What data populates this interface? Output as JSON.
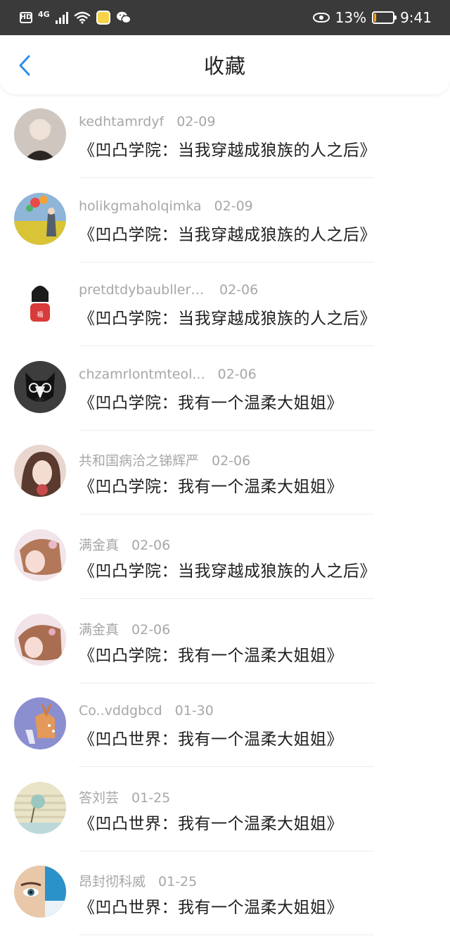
{
  "status_bar": {
    "hd_label": "HD",
    "network_label": "4G",
    "battery_percent_label": "13%",
    "battery_level": 0.13,
    "time": "9:41"
  },
  "header": {
    "title": "收藏",
    "back_icon": "chevron-left-icon"
  },
  "colors": {
    "accent": "#2b8ff0",
    "status_bar_bg": "#3a3a3a",
    "meta_text": "#a7a7a7",
    "title_text": "#1f1f1f"
  },
  "favorites": [
    {
      "username": "kedhtamrdyf",
      "date": "02-09",
      "title": "《凹凸学院：当我穿越成狼族的人之后》"
    },
    {
      "username": "holikgmaholqimka",
      "date": "02-09",
      "title": "《凹凸学院：当我穿越成狼族的人之后》"
    },
    {
      "username": "pretdtdybaublleri...",
      "date": "02-06",
      "title": "《凹凸学院：当我穿越成狼族的人之后》"
    },
    {
      "username": "chzamrlontmteol...",
      "date": "02-06",
      "title": "《凹凸学院：我有一个温柔大姐姐》"
    },
    {
      "username": "共和国病洽之锑辉严",
      "date": "02-06",
      "title": "《凹凸学院：我有一个温柔大姐姐》"
    },
    {
      "username": "满金真",
      "date": "02-06",
      "title": "《凹凸学院：当我穿越成狼族的人之后》"
    },
    {
      "username": "满金真",
      "date": "02-06",
      "title": "《凹凸学院：我有一个温柔大姐姐》"
    },
    {
      "username": "Co..vddgbcd",
      "date": "01-30",
      "title": "《凹凸世界：我有一个温柔大姐姐》"
    },
    {
      "username": "答刘芸",
      "date": "01-25",
      "title": "《凹凸世界：我有一个温柔大姐姐》"
    },
    {
      "username": "昂封彻科威",
      "date": "01-25",
      "title": "《凹凸世界：我有一个温柔大姐姐》"
    }
  ]
}
